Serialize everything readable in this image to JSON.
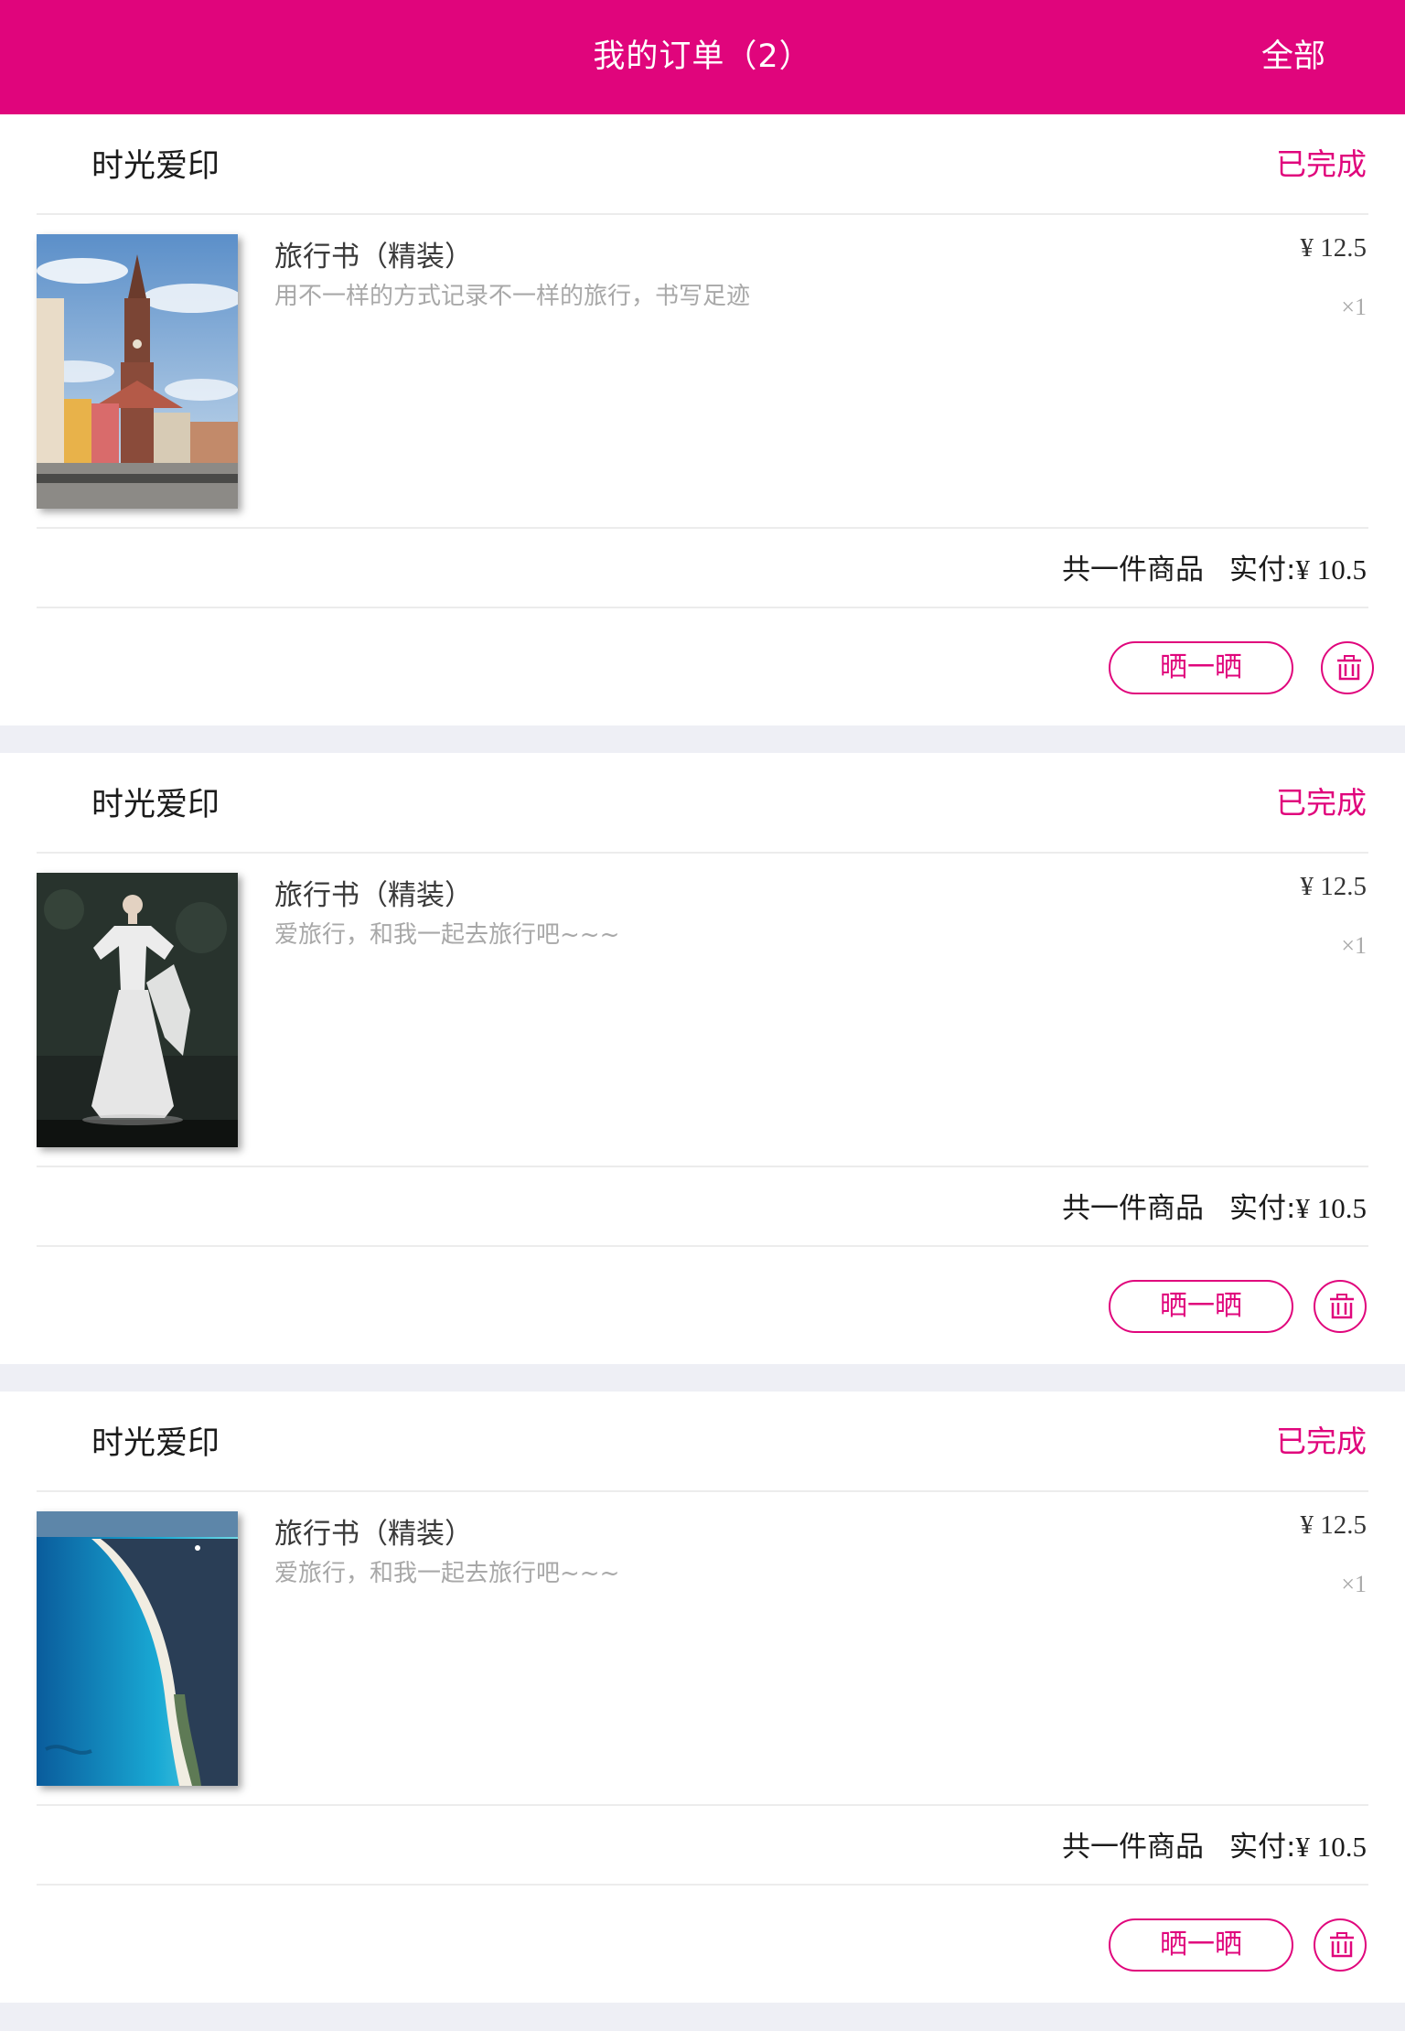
{
  "header": {
    "title": "我的订单（2）",
    "filter_label": "全部"
  },
  "colors": {
    "accent": "#e0057c",
    "background": "#eeeff5"
  },
  "orders": [
    {
      "shop": "时光爱印",
      "status": "已完成",
      "product_title": "旅行书（精装）",
      "product_desc": "用不一样的方式记录不一样的旅行，书写足迹",
      "price": "¥ 12.5",
      "quantity": "×1",
      "count_label": "共一件商品",
      "paid_label": "实付:",
      "paid_value": "¥ 10.5",
      "share_label": "晒一晒",
      "image": "cathedral-street-photo"
    },
    {
      "shop": "时光爱印",
      "status": "已完成",
      "product_title": "旅行书（精装）",
      "product_desc": "爱旅行，和我一起去旅行吧~~~",
      "price": "¥ 12.5",
      "quantity": "×1",
      "count_label": "共一件商品",
      "paid_label": "实付:",
      "paid_value": "¥ 10.5",
      "share_label": "晒一晒",
      "image": "white-dress-runway-photo"
    },
    {
      "shop": "时光爱印",
      "status": "已完成",
      "product_title": "旅行书（精装）",
      "product_desc": "爱旅行，和我一起去旅行吧~~~",
      "price": "¥ 12.5",
      "quantity": "×1",
      "count_label": "共一件商品",
      "paid_label": "实付:",
      "paid_value": "¥ 10.5",
      "share_label": "晒一晒",
      "image": "aerial-beach-photo"
    }
  ]
}
